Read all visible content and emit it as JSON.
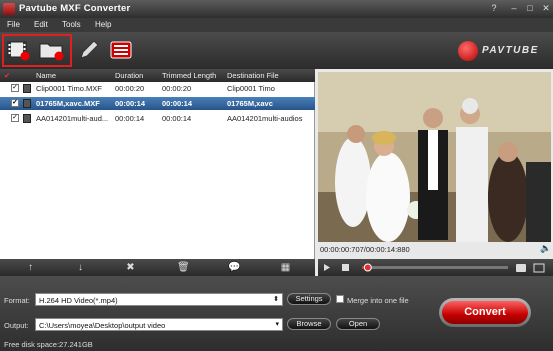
{
  "window": {
    "title": "Pavtube MXF Converter",
    "controls": [
      "?",
      "–",
      "□",
      "✕"
    ]
  },
  "menu": [
    "File",
    "Edit",
    "Tools",
    "Help"
  ],
  "toolbar": {
    "buttons": [
      "add-video",
      "add-folder",
      "edit",
      "merge-list"
    ]
  },
  "logo": "PAVTUBE",
  "file_list": {
    "headers": {
      "name": "Name",
      "duration": "Duration",
      "trimmed": "Trimmed Length",
      "destination": "Destination File"
    },
    "rows": [
      {
        "checked": true,
        "name": "Clip0001 Timo.MXF",
        "duration": "00:00:20",
        "trimmed": "00:00:20",
        "destination": "Clip0001 Timo",
        "selected": false
      },
      {
        "checked": true,
        "name": "01765M,xavc.MXF",
        "duration": "00:00:14",
        "trimmed": "00:00:14",
        "destination": "01765M,xavc",
        "selected": true
      },
      {
        "checked": true,
        "name": "AA014201multi-aud...",
        "duration": "00:00:14",
        "trimmed": "00:00:14",
        "destination": "AA014201multi-audios",
        "selected": false
      }
    ]
  },
  "player": {
    "time": "00:00:00:707/00:00:14:880",
    "progress": 0.04
  },
  "output": {
    "format_label": "Format:",
    "format_value": "H.264 HD Video(*.mp4)",
    "settings_label": "Settings",
    "merge_label": "Merge into one file",
    "output_label": "Output:",
    "output_value": "C:\\Users\\moyea\\Desktop\\output video",
    "browse_label": "Browse",
    "open_label": "Open",
    "disk_space": "Free disk space:27.241GB",
    "convert_label": "Convert"
  },
  "colors": {
    "accent": "#e02020",
    "selection": "#2f5f96",
    "convert": "#d00000"
  }
}
